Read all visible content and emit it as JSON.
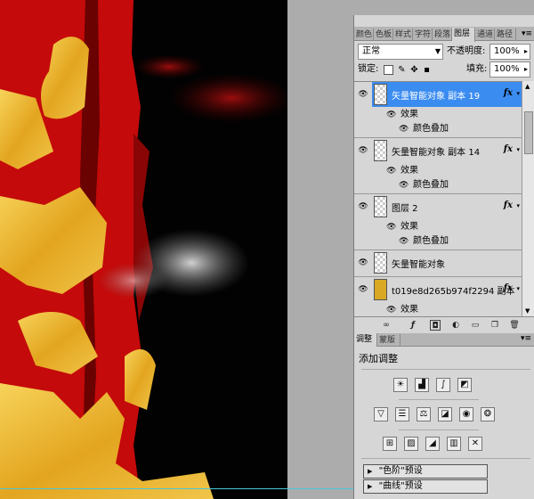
{
  "layers_panel": {
    "tabs": [
      "颜色",
      "色板",
      "样式",
      "字符",
      "段落",
      "图层",
      "通道",
      "路径"
    ],
    "active_tab": "图层",
    "blend_mode": "正常",
    "opacity_label": "不透明度:",
    "opacity_value": "100%",
    "lock_label": "锁定:",
    "fill_label": "填充:",
    "fill_value": "100%",
    "layers": [
      {
        "name": "矢量智能对象 副本 19",
        "fx": "fx",
        "effects_label": "效果",
        "effect": "颜色叠加",
        "selected": true
      },
      {
        "name": "矢量智能对象 副本 14",
        "fx": "fx",
        "effects_label": "效果",
        "effect": "颜色叠加",
        "selected": false
      },
      {
        "name": "图层 2",
        "fx": "fx",
        "effects_label": "效果",
        "effect": "颜色叠加",
        "selected": false
      },
      {
        "name": "矢量智能对象",
        "fx": "",
        "selected": false
      },
      {
        "name": "t019e8d265b974f2294 副本",
        "fx": "fx",
        "effects_label": "效果",
        "selected": false
      }
    ],
    "bottom_icons": [
      "link-icon",
      "fx-icon",
      "mask-icon",
      "adjustment-icon",
      "group-icon",
      "new-layer-icon",
      "trash-icon"
    ]
  },
  "adjustments_panel": {
    "tabs": [
      "调整",
      "蒙版"
    ],
    "title": "添加调整",
    "presets": [
      "\"色阶\"预设",
      "\"曲线\"预设"
    ]
  },
  "colors": {
    "selection_blue": "#3b8cf0",
    "canvas_red": "#c40a0a",
    "gold": "#e8b22a"
  }
}
